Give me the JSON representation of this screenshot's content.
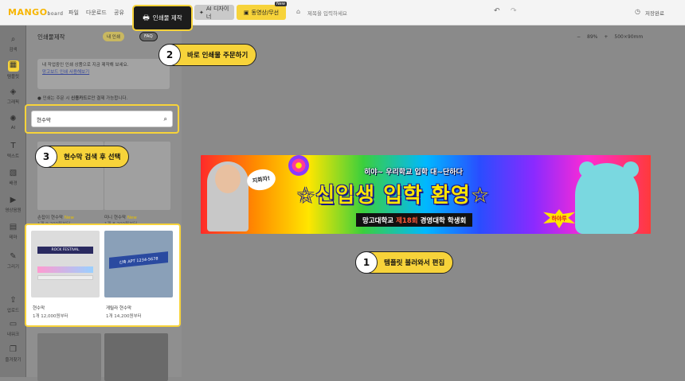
{
  "topbar": {
    "logo": "MANGO",
    "logo_sub": "board",
    "menu": [
      "파일",
      "다운로드",
      "공유"
    ],
    "print_button": "인쇄물 제작",
    "ai_designer": "AI 디자이너",
    "video_button": "동영상/무선",
    "new_badge": "New",
    "title_placeholder": "제목을 입력하세요",
    "saved_label": "저장완료"
  },
  "rail": [
    "검색",
    "템플릿",
    "그래픽",
    "AI",
    "텍스트",
    "배경",
    "영상음원",
    "테마"
  ],
  "rail_bottom": [
    "그리기",
    "업로드",
    "내워크",
    "즐겨찾기"
  ],
  "panel": {
    "title": "인쇄물제작",
    "my_print": "내 인쇄",
    "faq": "FAQ",
    "info_line1": "내 작업중인 인쇄 상품으로 지금 제작해 보세요.",
    "info_link": "망고보드 인쇄 사용해보기",
    "note_pre": "인쇄는 주문 시 ",
    "note_bold": "신용카드",
    "note_post": "로만 결제 가능합니다.",
    "search_value": "현수막",
    "cards_top": [
      {
        "name": "손잡이 현수막",
        "badge": "New",
        "price": "1개 9,200원부터"
      },
      {
        "name": "미니 현수막",
        "badge": "New",
        "price": "1개 8,200원부터"
      }
    ],
    "results": [
      {
        "name": "현수막",
        "price": "1개 12,000원부터"
      },
      {
        "name": "게릴라 현수막",
        "price": "1개 14,200원부터"
      }
    ],
    "result_thumb1_text": "ROCK FESTIVAL",
    "result_thumb2_text": "신축 APT 1234-5678"
  },
  "zoom": {
    "level": "89%",
    "size": "500×90mm"
  },
  "banner": {
    "top": "히야~ 우리학교 입학 대~단하다",
    "main": "☆신입생 입학 환영☆",
    "bubble": "지화자!",
    "sub_pre": "망고대학교",
    "sub_hl": "제18회",
    "sub_post": "경영대학 학생회",
    "burst": "하야루"
  },
  "callouts": [
    {
      "num": "1",
      "text": "템플릿 불러와서 편집"
    },
    {
      "num": "2",
      "text": "바로 인쇄물 주문하기"
    },
    {
      "num": "3",
      "text": "현수막 검색 후 선택"
    }
  ],
  "colors": {
    "accent": "#f7d33a",
    "dark": "#1c1c1c"
  }
}
